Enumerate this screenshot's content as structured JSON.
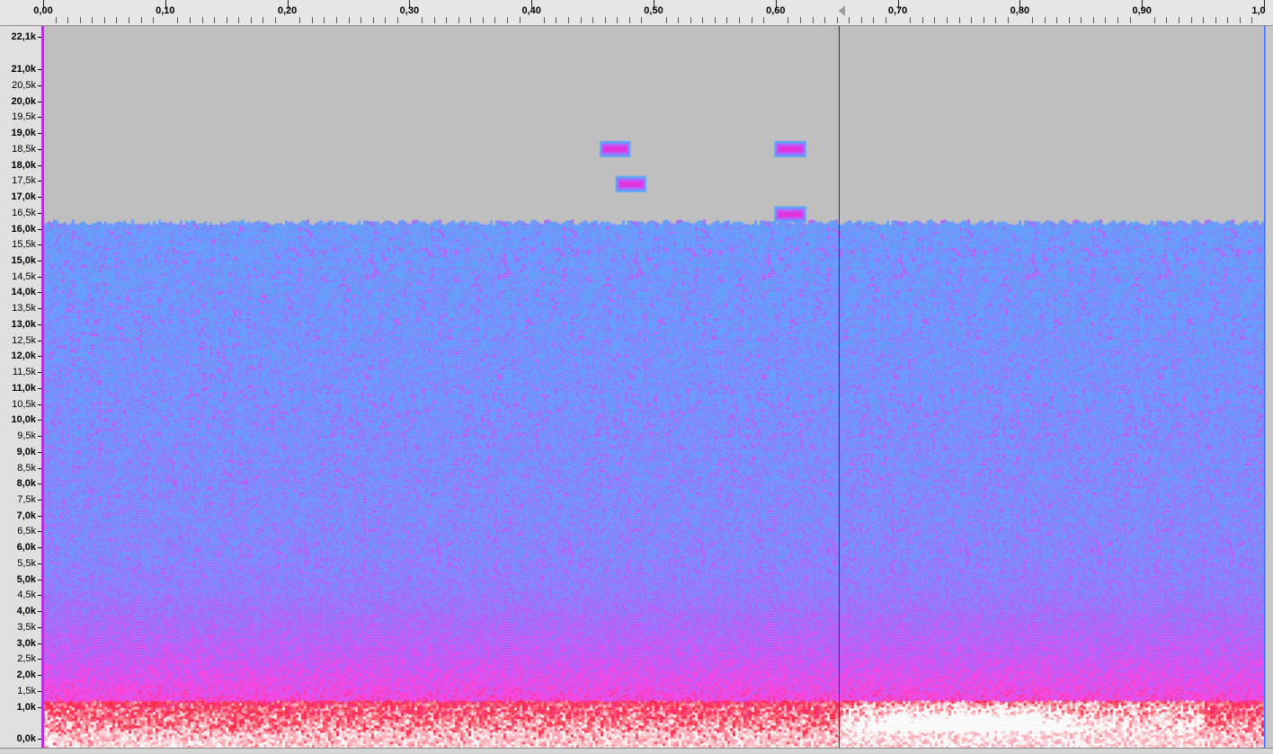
{
  "time_ruler": {
    "labels": [
      "0,00",
      "0,10",
      "0,20",
      "0,30",
      "0,40",
      "0,50",
      "0,60",
      "0,70",
      "0,80",
      "0,90",
      "1,0"
    ],
    "start": 0.0,
    "end": 1.0,
    "minor_divisions": 10,
    "cursor_time": 0.652
  },
  "frequency_axis": {
    "top_label": "22,1k",
    "labels": [
      {
        "hz": 21000,
        "text": "21,0k"
      },
      {
        "hz": 20500,
        "text": "20,5k"
      },
      {
        "hz": 20000,
        "text": "20,0k"
      },
      {
        "hz": 19500,
        "text": "19,5k"
      },
      {
        "hz": 19000,
        "text": "19,0k"
      },
      {
        "hz": 18500,
        "text": "18,5k"
      },
      {
        "hz": 18000,
        "text": "18,0k"
      },
      {
        "hz": 17500,
        "text": "17,5k"
      },
      {
        "hz": 17000,
        "text": "17,0k"
      },
      {
        "hz": 16500,
        "text": "16,5k"
      },
      {
        "hz": 16000,
        "text": "16,0k"
      },
      {
        "hz": 15500,
        "text": "15,5k"
      },
      {
        "hz": 15000,
        "text": "15,0k"
      },
      {
        "hz": 14500,
        "text": "14,5k"
      },
      {
        "hz": 14000,
        "text": "14,0k"
      },
      {
        "hz": 13500,
        "text": "13,5k"
      },
      {
        "hz": 13000,
        "text": "13,0k"
      },
      {
        "hz": 12500,
        "text": "12,5k"
      },
      {
        "hz": 12000,
        "text": "12,0k"
      },
      {
        "hz": 11500,
        "text": "11,5k"
      },
      {
        "hz": 11000,
        "text": "11,0k"
      },
      {
        "hz": 10500,
        "text": "10,5k"
      },
      {
        "hz": 10000,
        "text": "10,0k"
      },
      {
        "hz": 9500,
        "text": "9,5k"
      },
      {
        "hz": 9000,
        "text": "9,0k"
      },
      {
        "hz": 8500,
        "text": "8,5k"
      },
      {
        "hz": 8000,
        "text": "8,0k"
      },
      {
        "hz": 7500,
        "text": "7,5k"
      },
      {
        "hz": 7000,
        "text": "7,0k"
      },
      {
        "hz": 6500,
        "text": "6,5k"
      },
      {
        "hz": 6000,
        "text": "6,0k"
      },
      {
        "hz": 5500,
        "text": "5,5k"
      },
      {
        "hz": 5000,
        "text": "5,0k"
      },
      {
        "hz": 4500,
        "text": "4,5k"
      },
      {
        "hz": 4000,
        "text": "4,0k"
      },
      {
        "hz": 3500,
        "text": "3,5k"
      },
      {
        "hz": 3000,
        "text": "3,0k"
      },
      {
        "hz": 2500,
        "text": "2,5k"
      },
      {
        "hz": 2000,
        "text": "2,0k"
      },
      {
        "hz": 1500,
        "text": "1,5k"
      },
      {
        "hz": 1000,
        "text": "1,0k"
      },
      {
        "hz": 0,
        "text": "0,0k"
      }
    ],
    "max_hz": 22050
  },
  "spectrogram": {
    "background_color": "#bfbfbf",
    "noise_ceiling_hz": 16200,
    "palette": {
      "low_energy": "#5aa0ff",
      "mid_energy": "#b45aff",
      "high_energy": "#ff3ce6",
      "very_high_energy": "#ff1e3c",
      "peak": "#ffffff"
    },
    "tones": [
      {
        "t_start": 0.456,
        "t_end": 0.481,
        "hz": 18500
      },
      {
        "t_start": 0.469,
        "t_end": 0.494,
        "hz": 17400
      },
      {
        "t_start": 0.599,
        "t_end": 0.625,
        "hz": 18500
      },
      {
        "t_start": 0.599,
        "t_end": 0.625,
        "hz": 16450
      }
    ],
    "loud_low_region": {
      "t_start": 0.652,
      "t_end": 0.95,
      "hz_max": 1200
    }
  },
  "colors": {
    "track_border": "#b434d8",
    "track_end": "#3c6cff",
    "cursor": "#3a3a3a",
    "ruler_bg": "#e6e6e6",
    "axis_bg": "#e0e0e0"
  }
}
